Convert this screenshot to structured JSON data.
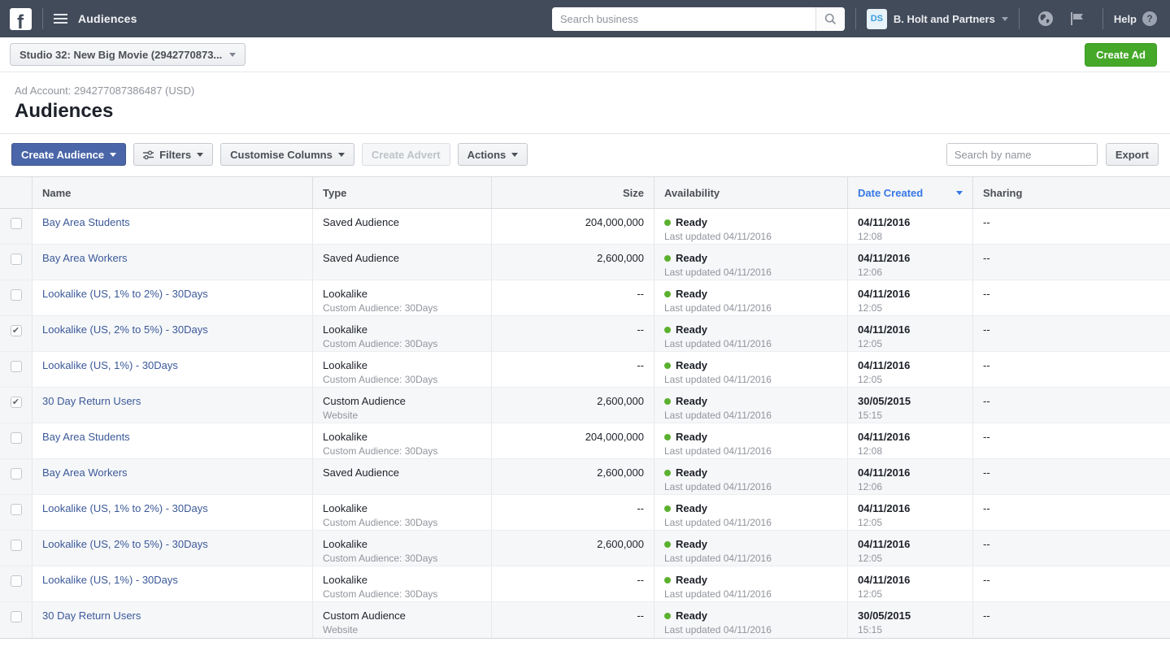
{
  "colors": {
    "topbar_bg": "#424b5a",
    "link_blue": "#3b5998",
    "sort_blue": "#3578e5",
    "primary_button_blue": "#4a66a8",
    "create_ad_green": "#45a829",
    "ready_green": "#5bb12f"
  },
  "topbar": {
    "app_title": "Audiences",
    "search_placeholder": "Search business",
    "business_badge": "DS",
    "business_name": "B. Holt and Partners",
    "help_label": "Help"
  },
  "account_bar": {
    "account_selector": "Studio 32: New Big Movie (2942770873...",
    "create_ad_label": "Create Ad"
  },
  "page": {
    "ad_account_line": "Ad Account: 294277087386487 (USD)",
    "title": "Audiences"
  },
  "toolbar": {
    "create_audience": "Create Audience",
    "filters": "Filters",
    "customise_columns": "Customise Columns",
    "create_advert": "Create Advert",
    "actions": "Actions",
    "search_placeholder": "Search by name",
    "export": "Export"
  },
  "table": {
    "columns": [
      "Name",
      "Type",
      "Size",
      "Availability",
      "Date Created",
      "Sharing"
    ],
    "sort": {
      "column": "Date Created",
      "direction": "desc"
    },
    "rows": [
      {
        "name": "Bay Area Students",
        "type": "Saved Audience",
        "type_sub": "",
        "size": "204,000,000",
        "status": "Ready",
        "status_sub": "Last updated 04/11/2016",
        "date": "04/11/2016",
        "time": "12:08",
        "sharing": "--",
        "checked": false
      },
      {
        "name": "Bay Area Workers",
        "type": "Saved Audience",
        "type_sub": "",
        "size": "2,600,000",
        "status": "Ready",
        "status_sub": "Last updated 04/11/2016",
        "date": "04/11/2016",
        "time": "12:06",
        "sharing": "--",
        "checked": false
      },
      {
        "name": "Lookalike (US, 1% to 2%) - 30Days",
        "type": "Lookalike",
        "type_sub": "Custom Audience: 30Days",
        "size": "--",
        "status": "Ready",
        "status_sub": "Last updated 04/11/2016",
        "date": "04/11/2016",
        "time": "12:05",
        "sharing": "--",
        "checked": false
      },
      {
        "name": "Lookalike (US, 2% to 5%) - 30Days",
        "type": "Lookalike",
        "type_sub": "Custom Audience: 30Days",
        "size": "--",
        "status": "Ready",
        "status_sub": "Last updated 04/11/2016",
        "date": "04/11/2016",
        "time": "12:05",
        "sharing": "--",
        "checked": true
      },
      {
        "name": "Lookalike (US, 1%) - 30Days",
        "type": "Lookalike",
        "type_sub": "Custom Audience: 30Days",
        "size": "--",
        "status": "Ready",
        "status_sub": "Last updated 04/11/2016",
        "date": "04/11/2016",
        "time": "12:05",
        "sharing": "--",
        "checked": false
      },
      {
        "name": "30 Day Return Users",
        "type": "Custom Audience",
        "type_sub": "Website",
        "size": "2,600,000",
        "status": "Ready",
        "status_sub": "Last updated 04/11/2016",
        "date": "30/05/2015",
        "time": "15:15",
        "sharing": "--",
        "checked": true
      },
      {
        "name": "Bay Area Students",
        "type": "Lookalike",
        "type_sub": "Custom Audience: 30Days",
        "size": "204,000,000",
        "status": "Ready",
        "status_sub": "Last updated 04/11/2016",
        "date": "04/11/2016",
        "time": "12:08",
        "sharing": "--",
        "checked": false
      },
      {
        "name": "Bay Area Workers",
        "type": "Saved Audience",
        "type_sub": "",
        "size": "2,600,000",
        "status": "Ready",
        "status_sub": "Last updated 04/11/2016",
        "date": "04/11/2016",
        "time": "12:06",
        "sharing": "--",
        "checked": false
      },
      {
        "name": "Lookalike (US, 1% to 2%) - 30Days",
        "type": "Lookalike",
        "type_sub": "Custom Audience: 30Days",
        "size": "--",
        "status": "Ready",
        "status_sub": "Last updated 04/11/2016",
        "date": "04/11/2016",
        "time": "12:05",
        "sharing": "--",
        "checked": false
      },
      {
        "name": "Lookalike (US, 2% to 5%) - 30Days",
        "type": "Lookalike",
        "type_sub": "Custom Audience: 30Days",
        "size": "2,600,000",
        "status": "Ready",
        "status_sub": "Last updated 04/11/2016",
        "date": "04/11/2016",
        "time": "12:05",
        "sharing": "--",
        "checked": false
      },
      {
        "name": "Lookalike (US, 1%) - 30Days",
        "type": "Lookalike",
        "type_sub": "Custom Audience: 30Days",
        "size": "--",
        "status": "Ready",
        "status_sub": "Last updated 04/11/2016",
        "date": "04/11/2016",
        "time": "12:05",
        "sharing": "--",
        "checked": false
      },
      {
        "name": "30 Day Return Users",
        "type": "Custom Audience",
        "type_sub": "Website",
        "size": "--",
        "status": "Ready",
        "status_sub": "Last updated 04/11/2016",
        "date": "30/05/2015",
        "time": "15:15",
        "sharing": "--",
        "checked": false
      }
    ]
  }
}
